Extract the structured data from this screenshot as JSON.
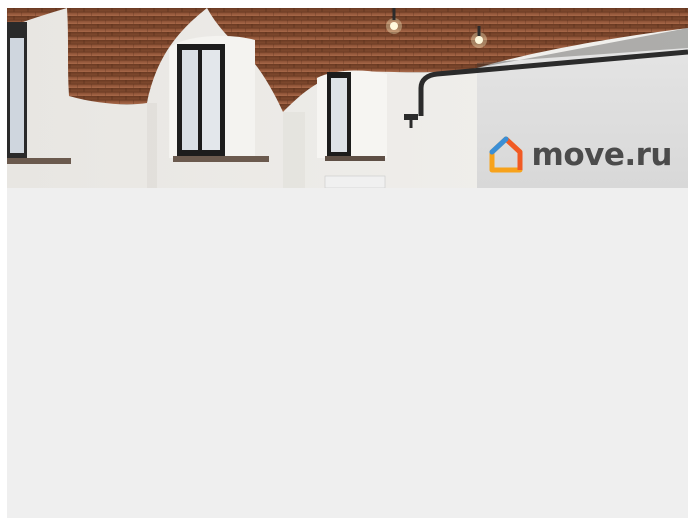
{
  "watermark": {
    "text": "move.ru",
    "icon": "house-logo-icon",
    "text_color": "#4b4b4b",
    "logo_colors": [
      "#f7a21b",
      "#f15a24",
      "#3b8fd6"
    ]
  },
  "photo": {
    "description_icon": "room-photo"
  },
  "background_color": "#efefef"
}
